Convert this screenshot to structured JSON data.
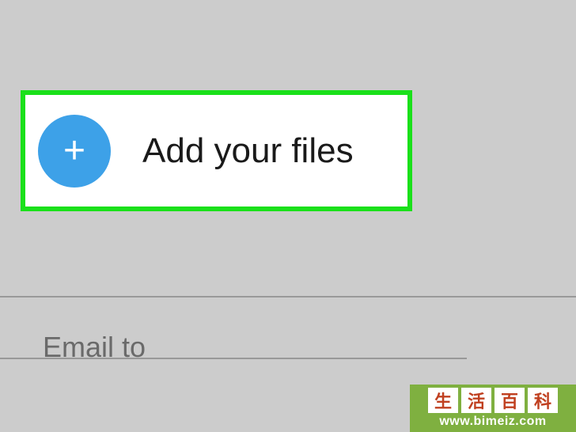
{
  "add_files": {
    "label": "Add your files",
    "icon_glyph": "+"
  },
  "email": {
    "label": "Email to"
  },
  "watermark": {
    "chars": [
      "生",
      "活",
      "百",
      "科"
    ],
    "url": "www.bimeiz.com"
  }
}
